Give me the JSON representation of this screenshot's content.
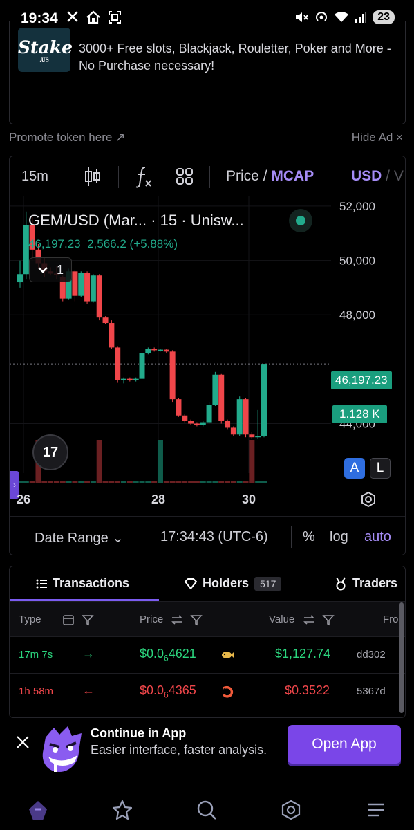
{
  "status_bar": {
    "time": "19:34",
    "battery": "23"
  },
  "ad": {
    "logo_text": "Stake",
    "logo_sub": ".US",
    "text": "3000+ Free slots, Blackjack, Rouletter, Poker and More - No Purchase necessary!",
    "promote_label": "Promote token here ↗",
    "hide_label": "Hide Ad ×"
  },
  "toolbar": {
    "interval": "15m",
    "price_label": "Price",
    "price_sep": " / ",
    "mcap_label": "MCAP",
    "currency_usd": "USD",
    "currency_sep": " / V"
  },
  "chart": {
    "pair_title": "GEM/USD (Mar... · 15 · Unisw...",
    "pair_value": "46,197.23",
    "pair_change": "2,566.2 (+5.88%)",
    "collapse_count": "1",
    "tv_logo": "17",
    "y_ticks": [
      "52,000",
      "50,000",
      "48,000",
      "44,000"
    ],
    "x_ticks": [
      "26",
      "28",
      "30"
    ],
    "last_price": "46,197.23",
    "last_volume": "1.128 K",
    "scale_a": "A",
    "scale_l": "L",
    "date_range": "Date Range ⌄",
    "timestamp": "17:34:43 (UTC-6)",
    "opt_percent": "%",
    "opt_log": "log",
    "opt_auto": "auto",
    "colors": {
      "up": "#22ab8c",
      "down": "#f0464a",
      "accent": "#a58cf5"
    }
  },
  "chart_data": {
    "type": "candlestick",
    "ylim": [
      43200,
      52100
    ],
    "y_ticks": [
      52000,
      50000,
      48000,
      44000
    ],
    "x_ticks": [
      "26",
      "28",
      "30"
    ],
    "candles": [
      {
        "o": 49200,
        "h": 50000,
        "l": 49000,
        "c": 49500
      },
      {
        "o": 49500,
        "h": 51800,
        "l": 49300,
        "c": 51300
      },
      {
        "o": 51300,
        "h": 51600,
        "l": 50000,
        "c": 50400
      },
      {
        "o": 50400,
        "h": 50600,
        "l": 49700,
        "c": 49900
      },
      {
        "o": 49900,
        "h": 50100,
        "l": 49400,
        "c": 49600
      },
      {
        "o": 49600,
        "h": 49750,
        "l": 49450,
        "c": 49520
      },
      {
        "o": 49520,
        "h": 49800,
        "l": 49300,
        "c": 49480
      },
      {
        "o": 49400,
        "h": 49450,
        "l": 48500,
        "c": 48600
      },
      {
        "o": 48600,
        "h": 49700,
        "l": 48550,
        "c": 49600
      },
      {
        "o": 49600,
        "h": 49650,
        "l": 48500,
        "c": 48700
      },
      {
        "o": 48700,
        "h": 49600,
        "l": 48650,
        "c": 49550
      },
      {
        "o": 49550,
        "h": 49600,
        "l": 48400,
        "c": 48500
      },
      {
        "o": 48500,
        "h": 49500,
        "l": 48450,
        "c": 49450
      },
      {
        "o": 49450,
        "h": 49500,
        "l": 47800,
        "c": 47900
      },
      {
        "o": 47900,
        "h": 47950,
        "l": 47650,
        "c": 47700
      },
      {
        "o": 47700,
        "h": 47800,
        "l": 46750,
        "c": 46800
      },
      {
        "o": 46800,
        "h": 46850,
        "l": 45500,
        "c": 45600
      },
      {
        "o": 45600,
        "h": 45700,
        "l": 45480,
        "c": 45650
      },
      {
        "o": 45650,
        "h": 45700,
        "l": 45550,
        "c": 45600
      },
      {
        "o": 45600,
        "h": 45700,
        "l": 45550,
        "c": 45650
      },
      {
        "o": 45650,
        "h": 46700,
        "l": 45600,
        "c": 46600
      },
      {
        "o": 46600,
        "h": 46800,
        "l": 46550,
        "c": 46750
      },
      {
        "o": 46750,
        "h": 46800,
        "l": 46650,
        "c": 46700
      },
      {
        "o": 46700,
        "h": 46750,
        "l": 46650,
        "c": 46720
      },
      {
        "o": 46720,
        "h": 46750,
        "l": 46600,
        "c": 46650
      },
      {
        "o": 46650,
        "h": 46700,
        "l": 44800,
        "c": 44900
      },
      {
        "o": 44900,
        "h": 44950,
        "l": 44250,
        "c": 44300
      },
      {
        "o": 44300,
        "h": 44350,
        "l": 44050,
        "c": 44100
      },
      {
        "o": 44100,
        "h": 44150,
        "l": 43950,
        "c": 44000
      },
      {
        "o": 44000,
        "h": 44050,
        "l": 43900,
        "c": 43950
      },
      {
        "o": 43950,
        "h": 44100,
        "l": 43900,
        "c": 44050
      },
      {
        "o": 44050,
        "h": 44800,
        "l": 44000,
        "c": 44700
      },
      {
        "o": 44700,
        "h": 45900,
        "l": 44650,
        "c": 45800
      },
      {
        "o": 45800,
        "h": 45850,
        "l": 44000,
        "c": 44100
      },
      {
        "o": 44100,
        "h": 44150,
        "l": 43800,
        "c": 43850
      },
      {
        "o": 43850,
        "h": 43900,
        "l": 43550,
        "c": 43600
      },
      {
        "o": 43600,
        "h": 45000,
        "l": 43550,
        "c": 44900
      },
      {
        "o": 44900,
        "h": 44950,
        "l": 43500,
        "c": 43600
      },
      {
        "o": 43600,
        "h": 43700,
        "l": 43450,
        "c": 43500
      },
      {
        "o": 43500,
        "h": 44500,
        "l": 43450,
        "c": 43550
      },
      {
        "o": 43550,
        "h": 46200,
        "l": 43500,
        "c": 46197
      }
    ],
    "volume_spikes": [
      3,
      13,
      23,
      38
    ]
  },
  "transactions": {
    "tabs": [
      {
        "label": "Transactions"
      },
      {
        "label": "Holders",
        "badge": "517"
      },
      {
        "label": "Traders"
      }
    ],
    "columns": [
      "Type",
      "Price",
      "Value",
      "Fro"
    ],
    "rows": [
      {
        "age": "17m 7s",
        "side": "buy",
        "arrow": "→",
        "price_a": "$0.0",
        "price_sub": "6",
        "price_b": "4621",
        "value": "$1,127.74",
        "maker": "dd302"
      },
      {
        "age": "1h 58m",
        "side": "sell",
        "arrow": "←",
        "price_a": "$0.0",
        "price_sub": "6",
        "price_b": "4365",
        "value": "$0.3522",
        "maker": "5367d"
      }
    ]
  },
  "promo": {
    "title": "Continue in App",
    "subtitle": "Easier interface, faster analysis.",
    "button": "Open App"
  }
}
